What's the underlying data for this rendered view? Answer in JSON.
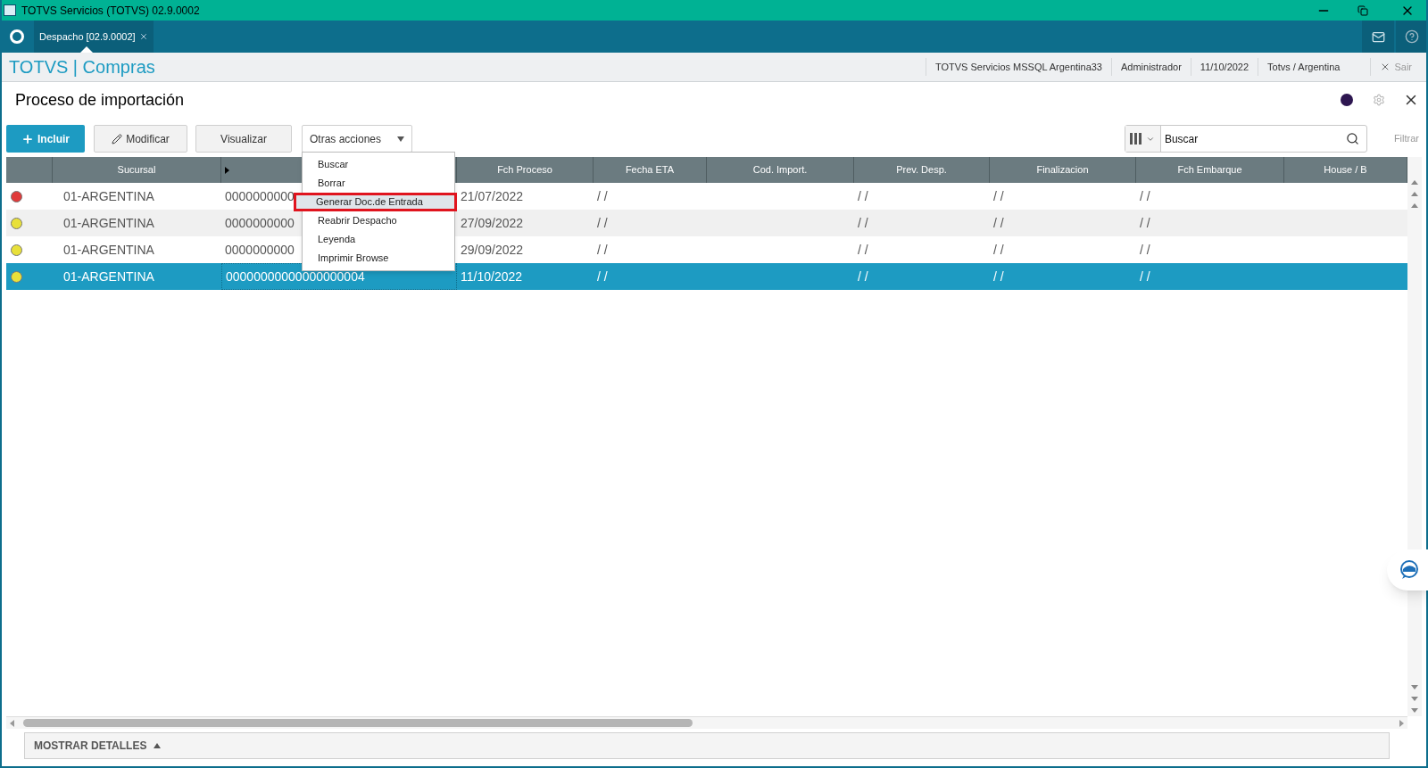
{
  "window": {
    "title": "TOTVS Servicios (TOTVS) 02.9.0002"
  },
  "tabs": [
    {
      "label": "Despacho [02.9.0002]",
      "selected": true
    }
  ],
  "header": {
    "brand": "TOTVS | Compras",
    "status_items": [
      "TOTVS Servicios MSSQL Argentina33",
      "Administrador",
      "11/10/2022",
      "Totvs / Argentina"
    ],
    "logout": "Sair"
  },
  "page": {
    "title": "Proceso de importación"
  },
  "toolbar": {
    "buttons": [
      {
        "label": "Incluir",
        "kind": "primary"
      },
      {
        "label": "Modificar",
        "kind": "edit"
      },
      {
        "label": "Visualizar",
        "kind": "plain"
      },
      {
        "label": "Otras acciones",
        "kind": "menu"
      }
    ],
    "search": {
      "placeholder": "Buscar"
    },
    "filter": "Filtrar"
  },
  "menu": {
    "items": [
      {
        "label": "Buscar",
        "selected": false
      },
      {
        "label": "Borrar",
        "selected": false
      },
      {
        "label": "Generar Doc.de Entrada",
        "selected": true
      },
      {
        "label": "Reabrir Despacho",
        "selected": false
      },
      {
        "label": "Leyenda",
        "selected": false
      },
      {
        "label": "Imprimir Browse",
        "selected": false
      }
    ]
  },
  "table": {
    "columns": [
      {
        "label": "Sucursal"
      },
      {
        "sorted": true
      },
      {
        "label": "Fch Proceso"
      },
      {
        "label": "Fecha ETA"
      },
      {
        "label": "Cod. Import."
      },
      {
        "label": "Prev. Desp."
      },
      {
        "label": "Finalizacion"
      },
      {
        "label": "Fch Embarque"
      },
      {
        "label": "House / B"
      }
    ],
    "rows": [
      {
        "color": "#e03a3a",
        "selected": false,
        "cells": [
          "01-ARGENTINA",
          "0000000000",
          "21/07/2022",
          "/ /",
          null,
          "/ /",
          "/ /",
          "/ /",
          null
        ]
      },
      {
        "color": "#e8e03a",
        "selected": false,
        "cells": [
          "01-ARGENTINA",
          "0000000000",
          "27/09/2022",
          "/ /",
          null,
          "/ /",
          "/ /",
          "/ /",
          null
        ]
      },
      {
        "color": "#e8e03a",
        "selected": false,
        "cells": [
          "01-ARGENTINA",
          "0000000000",
          "29/09/2022",
          "/ /",
          null,
          "/ /",
          "/ /",
          "/ /",
          null
        ]
      },
      {
        "color": "#e8e03a",
        "selected": true,
        "cells": [
          "01-ARGENTINA",
          "00000000000000000004",
          "11/10/2022",
          "/ /",
          null,
          "/ /",
          "/ /",
          "/ /",
          null
        ]
      }
    ]
  },
  "footer": {
    "details_toggle": "MOSTRAR DETALLES"
  }
}
